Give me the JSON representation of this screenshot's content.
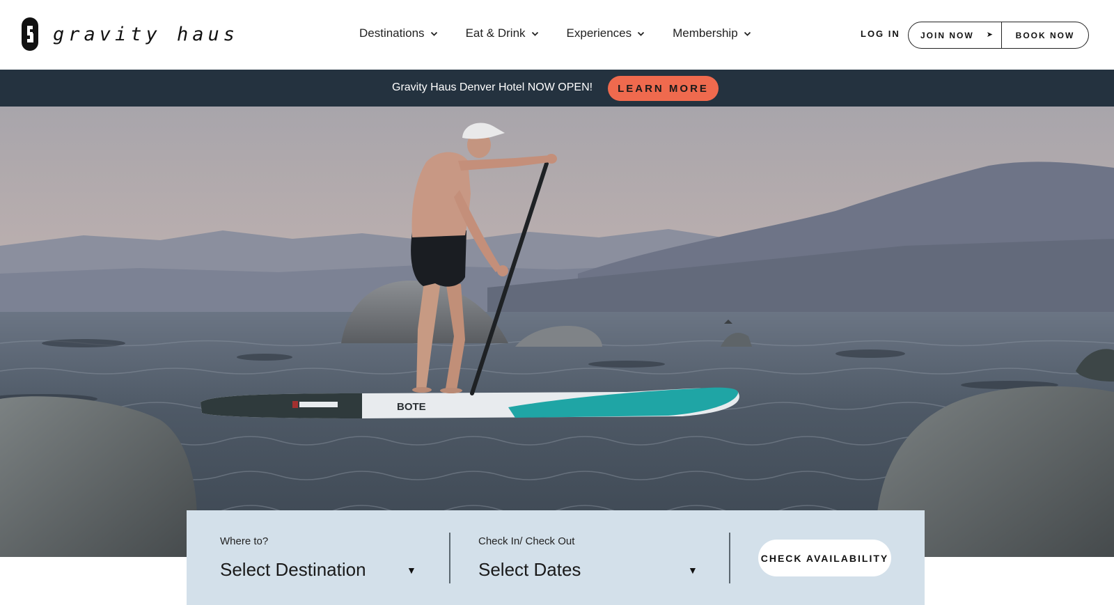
{
  "header": {
    "logo_text": "gravity haus",
    "nav": [
      {
        "label": "Destinations",
        "icon": "chevron-down-icon"
      },
      {
        "label": "Eat & Drink",
        "icon": "chevron-down-icon"
      },
      {
        "label": "Experiences",
        "icon": "chevron-down-icon"
      },
      {
        "label": "Membership",
        "icon": "chevron-down-icon"
      }
    ],
    "login_label": "LOG IN",
    "join_label": "JOIN NOW",
    "join_icon": "arrow-right-icon",
    "book_label": "BOOK NOW"
  },
  "announcement": {
    "text": "Gravity Haus Denver Hotel NOW OPEN!",
    "button_label": "LEARN MORE",
    "bar_color": "#24323f",
    "button_color": "#ef6a4e"
  },
  "hero": {
    "image": "paddleboarder-on-lake-at-dusk",
    "board_brand": "BOTE"
  },
  "booking": {
    "destination_label": "Where to?",
    "destination_value": "Select Destination",
    "dates_label": "Check In/ Check Out",
    "dates_value": "Select Dates",
    "caret_icon": "caret-down-icon",
    "check_label": "CHECK AVAILABILITY",
    "panel_color": "#d3e0ea"
  }
}
